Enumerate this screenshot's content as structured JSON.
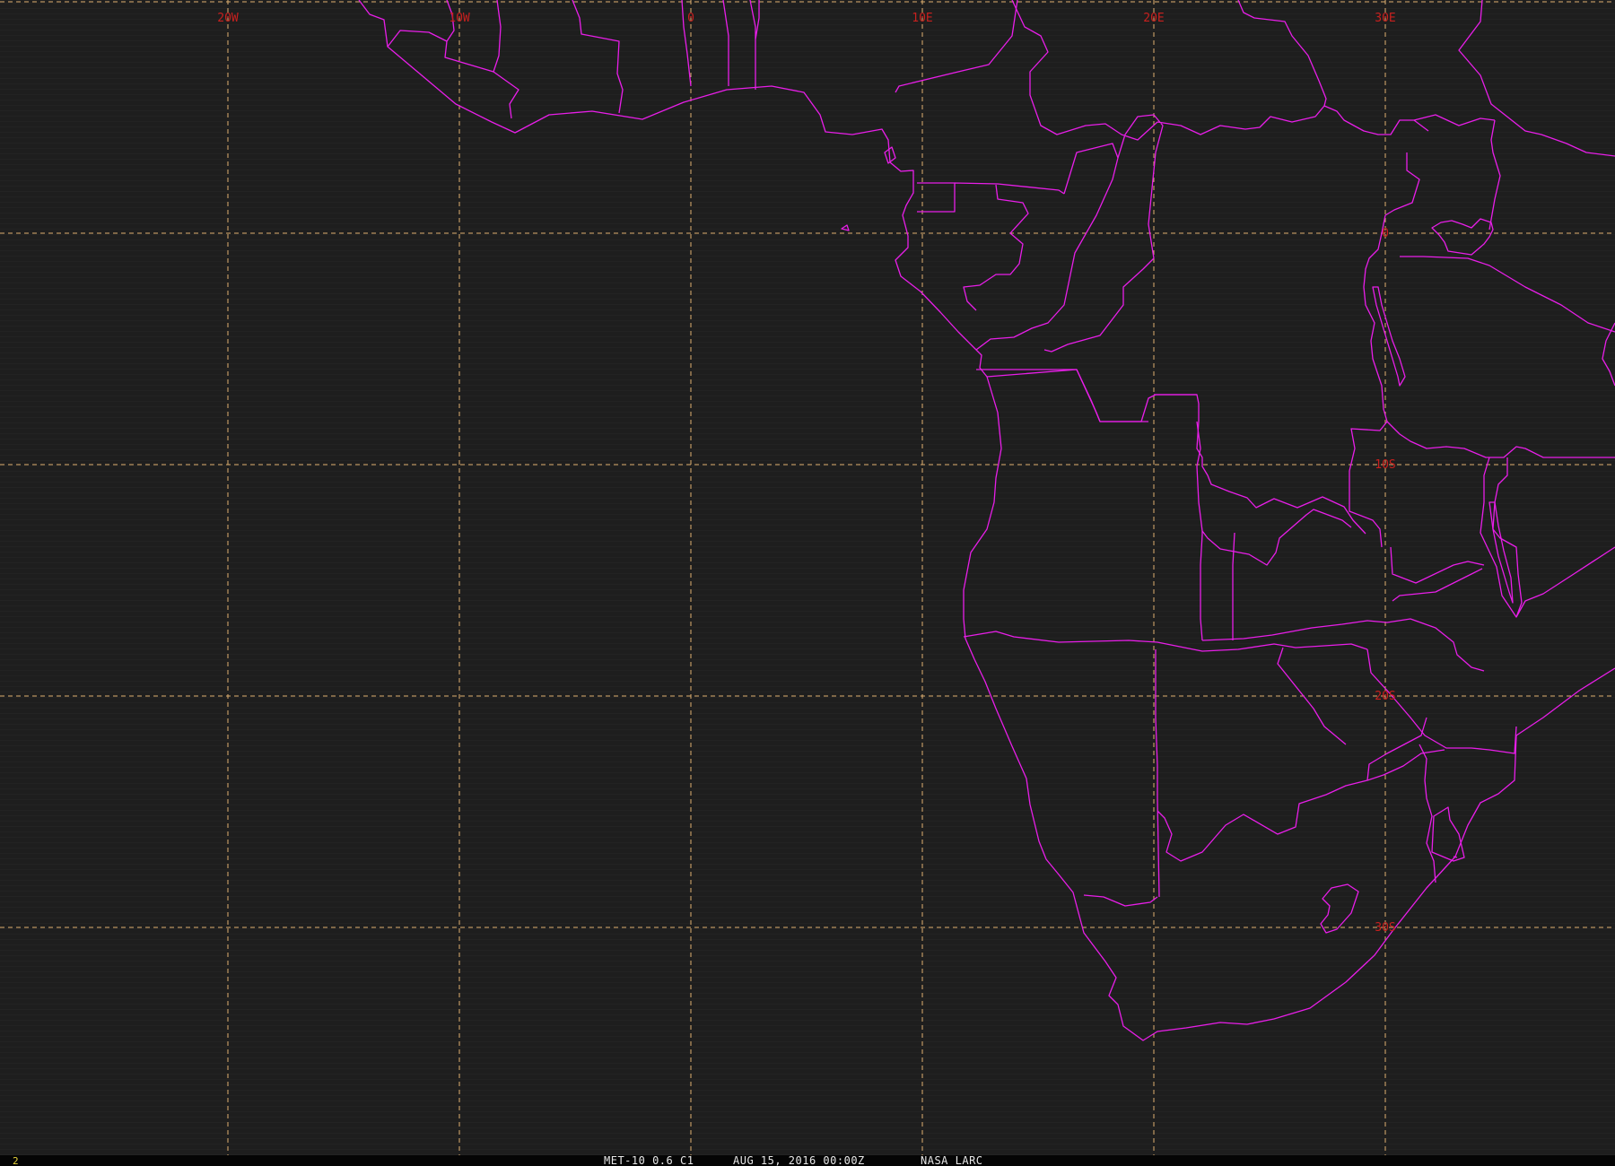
{
  "frame_number": "2",
  "caption": {
    "satellite": "MET-10 0.6 C1",
    "datetime": "AUG 15, 2016 00:00Z",
    "source": "NASA LARC"
  },
  "colors": {
    "background": "#1e1e1e",
    "grid": "#e0b070",
    "coastline": "#e81ee8",
    "grid_label": "#c8201e",
    "footer_bar": "#050505",
    "frame_number": "#e6d23a"
  },
  "grid": {
    "longitudes": [
      {
        "value": -20,
        "label": "20W"
      },
      {
        "value": -10,
        "label": "10W"
      },
      {
        "value": 0,
        "label": "0"
      },
      {
        "value": 10,
        "label": "10E"
      },
      {
        "value": 20,
        "label": "20E"
      },
      {
        "value": 30,
        "label": "30E"
      }
    ],
    "latitudes": [
      {
        "value": 10,
        "label": ""
      },
      {
        "value": 0,
        "label": "0"
      },
      {
        "value": -10,
        "label": "10S"
      },
      {
        "value": -20,
        "label": "20S"
      },
      {
        "value": -30,
        "label": "30S"
      }
    ]
  }
}
